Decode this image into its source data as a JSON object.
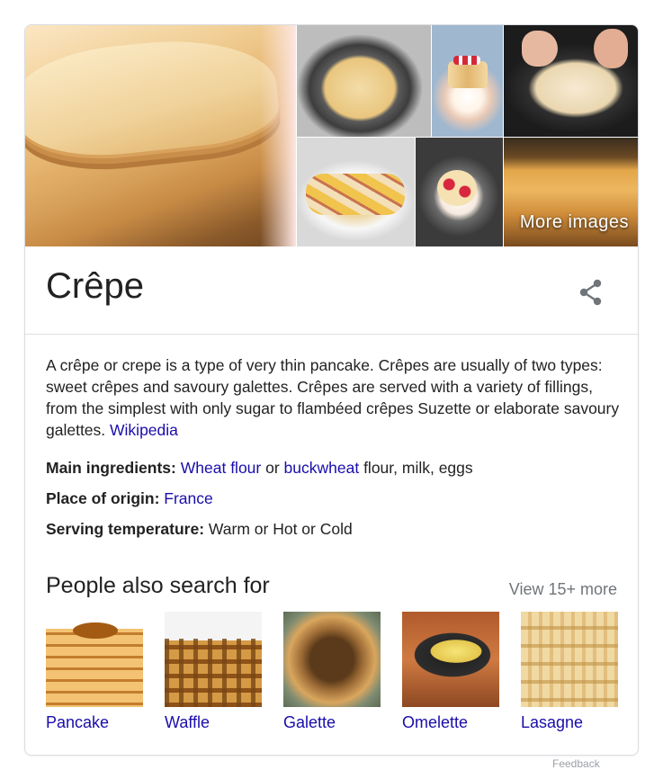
{
  "images": {
    "more_images_label": "More images"
  },
  "entity": {
    "title": "Crêpe",
    "share_icon": "share-icon"
  },
  "description": {
    "text": "A crêpe or crepe is a type of very thin pancake. Crêpes are usually of two types: sweet crêpes and savoury galettes. Crêpes are served with a variety of fillings, from the simplest with only sugar to flambéed crêpes Suzette or elaborate savoury galettes. ",
    "source_link": "Wikipedia"
  },
  "facts": {
    "ingredients": {
      "label": "Main ingredients:",
      "link1": "Wheat flour",
      "connector": " or ",
      "link2": "buckwheat",
      "rest": " flour, milk, eggs"
    },
    "origin": {
      "label": "Place of origin:",
      "link": "France"
    },
    "temperature": {
      "label": "Serving temperature:",
      "value": "Warm or Hot or Cold"
    }
  },
  "people_also_search": {
    "title": "People also search for",
    "view_more": "View 15+ more",
    "items": [
      {
        "label": "Pancake"
      },
      {
        "label": "Waffle"
      },
      {
        "label": "Galette"
      },
      {
        "label": "Omelette"
      },
      {
        "label": "Lasagne"
      }
    ]
  },
  "footer": {
    "hint": "Feedback"
  },
  "colors": {
    "link": "#1a0dab",
    "text": "#222222",
    "muted": "#70757a",
    "border": "#dadce0"
  }
}
